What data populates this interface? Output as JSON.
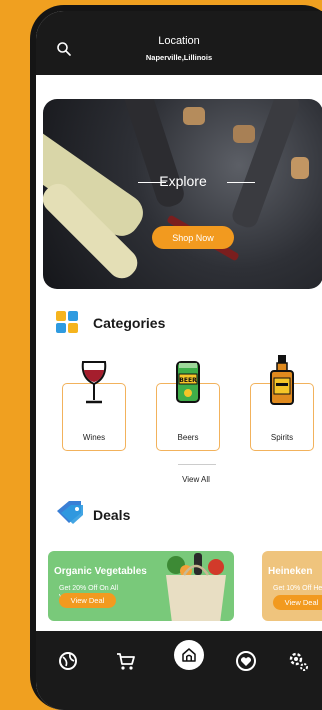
{
  "header": {
    "location_title": "Location",
    "location_value": "Naperville,Lillinois"
  },
  "hero": {
    "heading": "Explore",
    "button_label": "Shop Now"
  },
  "categories": {
    "title": "Categories",
    "items": [
      {
        "label": "Wines",
        "icon": "wine-glass-icon"
      },
      {
        "label": "Beers",
        "icon": "beer-can-icon"
      },
      {
        "label": "Spirits",
        "icon": "spirits-bottle-icon"
      }
    ],
    "view_all_label": "View All"
  },
  "deals": {
    "title": "Deals",
    "items": [
      {
        "title": "Organic Vegetables",
        "subtitle": "Get 20% Off On All Vegetables",
        "button_label": "View Deal"
      },
      {
        "title": "Heineken",
        "subtitle": "Get 10% Off Heineken",
        "button_label": "View Deal"
      }
    ]
  },
  "bottom_nav": {
    "items": [
      "explore-icon",
      "cart-icon",
      "home-icon",
      "favorites-icon",
      "settings-icon"
    ],
    "active": "home-icon"
  },
  "colors": {
    "accent": "#F29A1F",
    "background": "#F0A020",
    "bar": "#1A1A1A",
    "card_border": "#F2B25C",
    "deal_green": "#79C97A",
    "deal_tan": "#EFC47D"
  }
}
